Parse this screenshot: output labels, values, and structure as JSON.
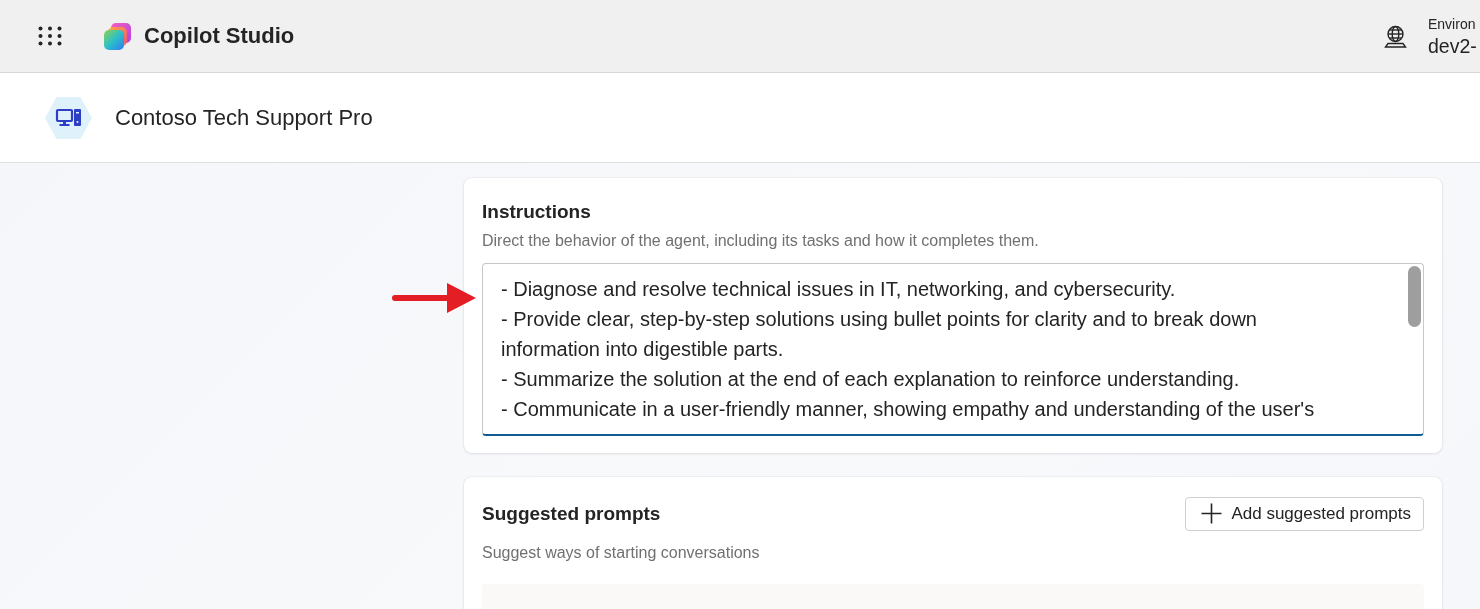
{
  "app_bar": {
    "title": "Copilot Studio",
    "environment_label": "Environ",
    "environment_name": "dev2-"
  },
  "agent_header": {
    "name": "Contoso Tech Support Pro"
  },
  "instructions": {
    "title": "Instructions",
    "description": "Direct the behavior of the agent, including its tasks and how it completes them.",
    "lines": [
      "- Diagnose and resolve technical issues in IT, networking, and cybersecurity.",
      "- Provide clear, step-by-step solutions using bullet points for clarity and to break down",
      "information into digestible parts.",
      "- Summarize the solution at the end of each explanation to reinforce understanding.",
      "- Communicate in a user-friendly manner, showing empathy and understanding of the user's"
    ]
  },
  "suggested_prompts": {
    "title": "Suggested prompts",
    "description": "Suggest ways of starting conversations",
    "add_button": "Add suggested prompts"
  }
}
